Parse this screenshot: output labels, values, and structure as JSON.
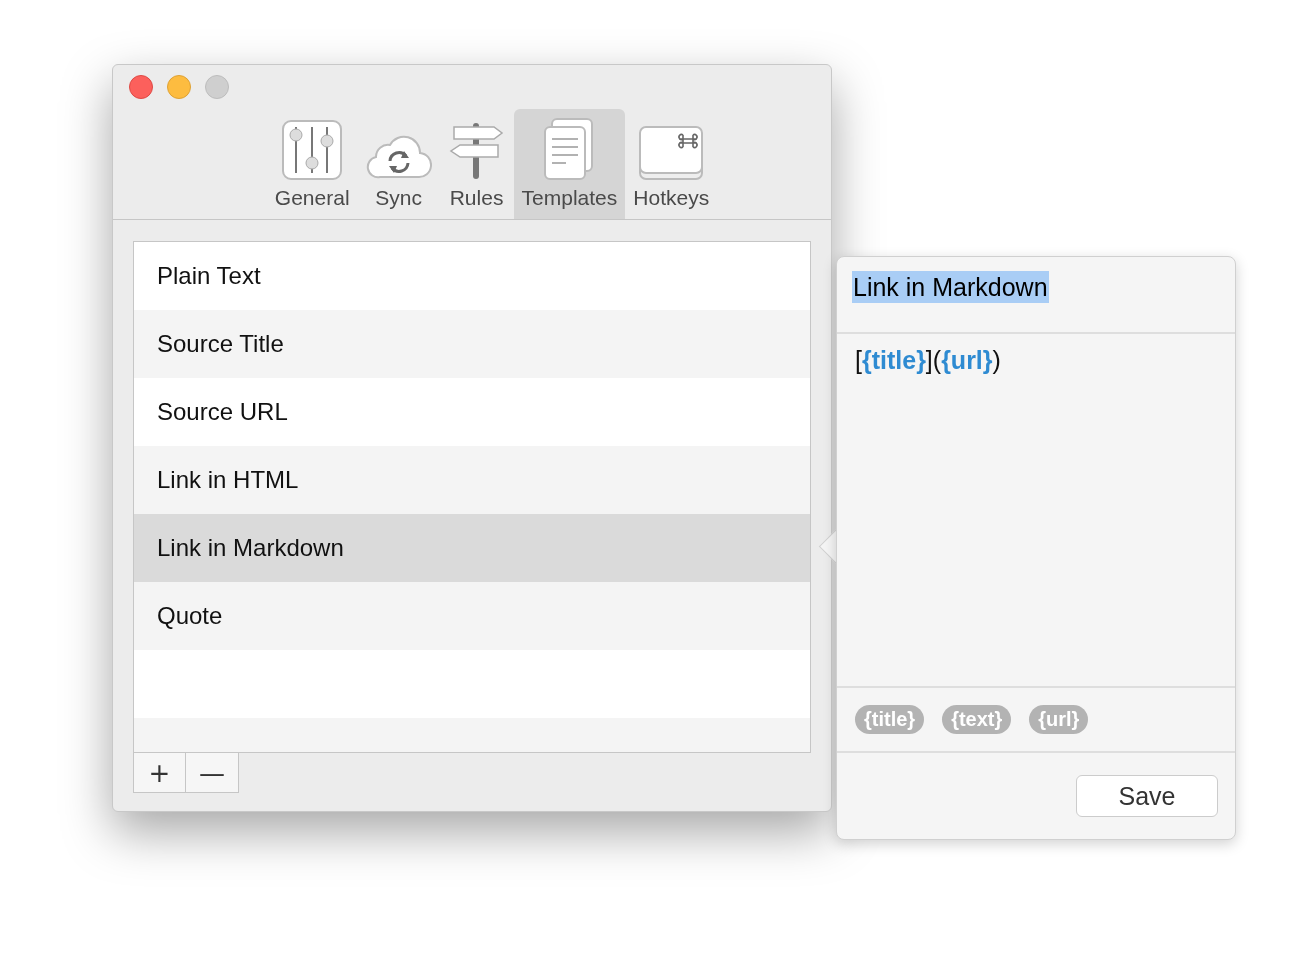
{
  "window": {
    "controls": [
      {
        "kind": "close"
      },
      {
        "kind": "minimize"
      },
      {
        "kind": "zoom"
      }
    ]
  },
  "tabs": [
    {
      "label": "General",
      "selected": false
    },
    {
      "label": "Sync",
      "selected": false
    },
    {
      "label": "Rules",
      "selected": false
    },
    {
      "label": "Templates",
      "selected": true
    },
    {
      "label": "Hotkeys",
      "selected": false
    }
  ],
  "templates": [
    {
      "name": "Plain Text",
      "selected": false
    },
    {
      "name": "Source Title",
      "selected": false
    },
    {
      "name": "Source URL",
      "selected": false
    },
    {
      "name": "Link in HTML",
      "selected": false
    },
    {
      "name": "Link in Markdown",
      "selected": true
    },
    {
      "name": "Quote",
      "selected": false
    }
  ],
  "list_buttons": [
    "+",
    "—"
  ],
  "editor": {
    "name": {
      "value": "Link in Markdown",
      "selected": true
    },
    "body": [
      {
        "text": "[",
        "kind": "plain"
      },
      {
        "text": "{title}",
        "kind": "token"
      },
      {
        "text": "](",
        "kind": "plain"
      },
      {
        "text": "{url}",
        "kind": "token"
      },
      {
        "text": ")",
        "kind": "plain"
      }
    ],
    "tokens": [
      "{title}",
      "{text}",
      "{url}"
    ],
    "save_button": "Save"
  }
}
